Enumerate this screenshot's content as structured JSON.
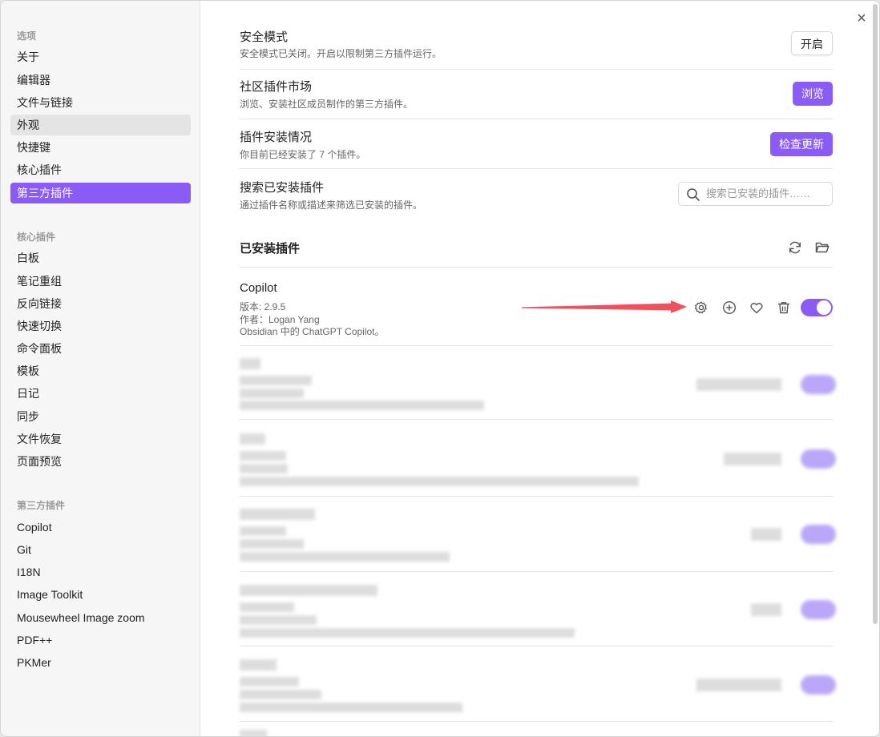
{
  "window": {
    "close_label": "×"
  },
  "sidebar": {
    "options_heading": "选项",
    "options": [
      {
        "label": "关于",
        "state": "normal"
      },
      {
        "label": "编辑器",
        "state": "normal"
      },
      {
        "label": "文件与链接",
        "state": "normal"
      },
      {
        "label": "外观",
        "state": "hover"
      },
      {
        "label": "快捷键",
        "state": "normal"
      },
      {
        "label": "核心插件",
        "state": "normal"
      },
      {
        "label": "第三方插件",
        "state": "active"
      }
    ],
    "core_heading": "核心插件",
    "core": [
      "白板",
      "笔记重组",
      "反向链接",
      "快速切换",
      "命令面板",
      "模板",
      "日记",
      "同步",
      "文件恢复",
      "页面预览"
    ],
    "community_heading": "第三方插件",
    "community": [
      "Copilot",
      "Git",
      "I18N",
      "Image Toolkit",
      "Mousewheel Image zoom",
      "PDF++",
      "PKMer"
    ]
  },
  "settings": {
    "safe_mode": {
      "name": "安全模式",
      "desc": "安全模式已关闭。开启以限制第三方插件运行。",
      "button": "开启"
    },
    "market": {
      "name": "社区插件市场",
      "desc": "浏览、安装社区成员制作的第三方插件。",
      "button": "浏览"
    },
    "status": {
      "name": "插件安装情况",
      "desc": "你目前已经安装了 7 个插件。",
      "button": "检查更新"
    },
    "search": {
      "name": "搜索已安装插件",
      "desc": "通过插件名称或描述来筛选已安装的插件。",
      "placeholder": "搜索已安装的插件……"
    }
  },
  "installed": {
    "heading": "已安装插件",
    "reload_icon": "reload-icon",
    "folder_icon": "folder-icon",
    "first": {
      "name": "Copilot",
      "version": "版本: 2.9.5",
      "author": "作者：Logan Yang",
      "description": "Obsidian 中的 ChatGPT Copilot。",
      "enabled": true
    }
  },
  "colors": {
    "accent": "#8a5cf5",
    "annotation_arrow": "#f2505d"
  }
}
